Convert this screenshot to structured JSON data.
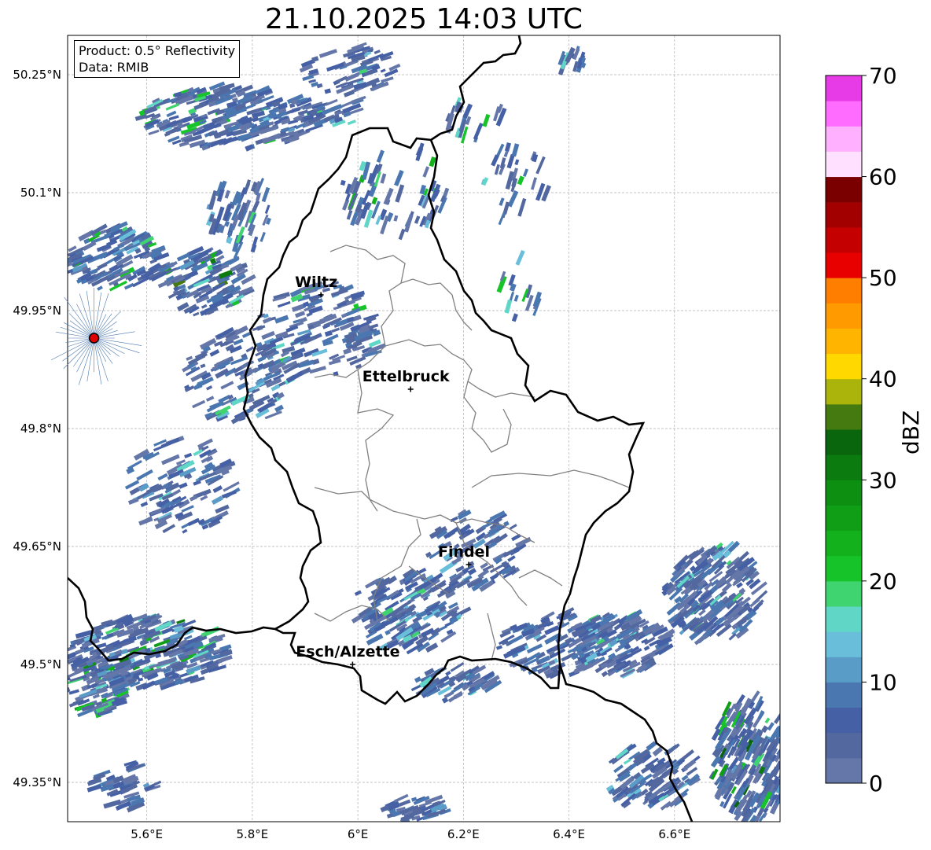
{
  "title": "21.10.2025 14:03 UTC",
  "info": {
    "product": "Product: 0.5° Reflectivity",
    "data": "Data: RMIB"
  },
  "map": {
    "lon_range": [
      5.45,
      6.8
    ],
    "lat_range": [
      49.3,
      50.3
    ],
    "lat_ticks": [
      {
        "value": 50.25,
        "label": "50.25°N"
      },
      {
        "value": 50.1,
        "label": "50.1°N"
      },
      {
        "value": 49.95,
        "label": "49.95°N"
      },
      {
        "value": 49.8,
        "label": "49.8°N"
      },
      {
        "value": 49.65,
        "label": "49.65°N"
      },
      {
        "value": 49.5,
        "label": "49.5°N"
      },
      {
        "value": 49.35,
        "label": "49.35°N"
      }
    ],
    "lon_ticks": [
      {
        "value": 5.6,
        "label": "5.6°E"
      },
      {
        "value": 5.8,
        "label": "5.8°E"
      },
      {
        "value": 6.0,
        "label": "6°E"
      },
      {
        "value": 6.2,
        "label": "6.2°E"
      },
      {
        "value": 6.4,
        "label": "6.4°E"
      },
      {
        "value": 6.6,
        "label": "6.6°E"
      }
    ],
    "cities": [
      {
        "name": "Wiltz",
        "lon": 5.93,
        "lat": 49.97
      },
      {
        "name": "Ettelbruck",
        "lon": 6.1,
        "lat": 49.85
      },
      {
        "name": "Findel",
        "lon": 6.21,
        "lat": 49.627
      },
      {
        "name": "Esch/Alzette",
        "lon": 5.99,
        "lat": 49.5
      }
    ],
    "radar_site": {
      "lon": 5.5,
      "lat": 49.915
    }
  },
  "colorbar": {
    "label": "dBZ",
    "min": 0,
    "max": 70,
    "step": 2.5,
    "tick_labels": [
      "0",
      "10",
      "20",
      "30",
      "40",
      "50",
      "60",
      "70"
    ],
    "colors": [
      "#6577a8",
      "#5468a0",
      "#4560a4",
      "#4a77b0",
      "#5a9cc8",
      "#69bfda",
      "#5fd6c6",
      "#3fd470",
      "#16c42a",
      "#13b21c",
      "#0f9e16",
      "#0d8f12",
      "#0b7b10",
      "#09660c",
      "#457a10",
      "#aab40a",
      "#ffd800",
      "#ffb400",
      "#ff9b00",
      "#ff7e00",
      "#e80000",
      "#c40000",
      "#a20000",
      "#7a0000",
      "#ffe0ff",
      "#ffb0ff",
      "#ff6cff",
      "#e83be8"
    ]
  }
}
